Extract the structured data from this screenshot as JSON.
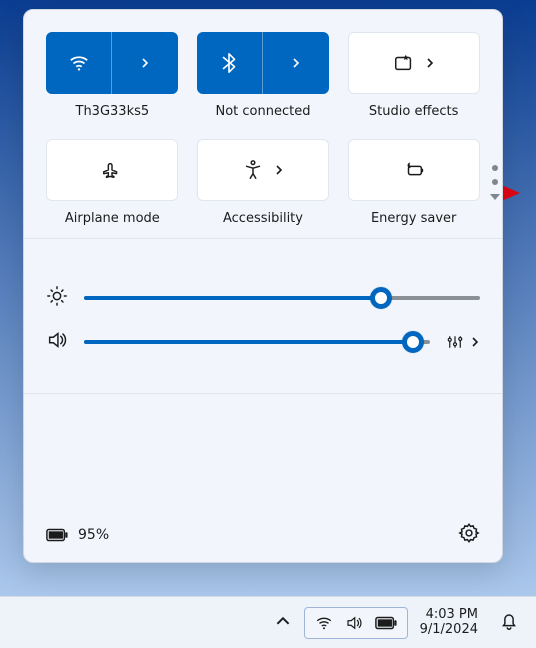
{
  "tiles": {
    "wifi": {
      "label": "Th3G33ks5",
      "active": true,
      "expandable": true
    },
    "bluetooth": {
      "label": "Not connected",
      "active": true,
      "expandable": true
    },
    "studio": {
      "label": "Studio effects",
      "active": false,
      "expandable": true
    },
    "airplane": {
      "label": "Airplane mode",
      "active": false,
      "expandable": false
    },
    "accessibility": {
      "label": "Accessibility",
      "active": false,
      "expandable": true
    },
    "energy": {
      "label": "Energy saver",
      "active": false,
      "expandable": false
    }
  },
  "sliders": {
    "brightness": {
      "value": 75
    },
    "volume": {
      "value": 95
    }
  },
  "footer": {
    "battery_text": "95%"
  },
  "page_indicator": {
    "total": 3,
    "current": 1
  },
  "annotation": {
    "arrow_color": "#e30613"
  },
  "taskbar": {
    "time": "4:03 PM",
    "date": "9/1/2024"
  }
}
